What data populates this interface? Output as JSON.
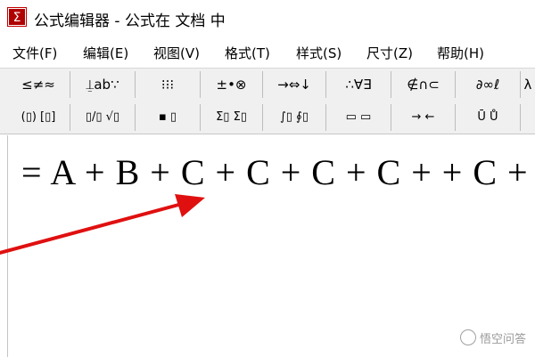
{
  "window": {
    "title": "公式编辑器 - 公式在 文档 中",
    "icon": "sigma-formula-editor-icon"
  },
  "menubar": {
    "items": [
      "文件(F)",
      "编辑(E)",
      "视图(V)",
      "格式(T)",
      "样式(S)",
      "尺寸(Z)",
      "帮助(H)"
    ]
  },
  "toolbar": {
    "row1": [
      "≤≠≈",
      "⍊ab∵",
      "⁝⁝⁝",
      "±•⊗",
      "→⇔↓",
      "∴∀∃",
      "∉∩⊂",
      "∂∞ℓ",
      "λ"
    ],
    "row2": [
      "(▯) [▯]",
      "▯/▯ √▯",
      "▪ ▯",
      "Σ▯ Σ▯",
      "∫▯ ∮▯",
      "▭ ▭",
      "→ ←",
      "Ū Ů"
    ]
  },
  "document": {
    "equation": "= A + B + C + C + C + C + + C +"
  },
  "annotation": {
    "arrow_color": "#e01010"
  },
  "watermark": {
    "text": "悟空问答"
  }
}
